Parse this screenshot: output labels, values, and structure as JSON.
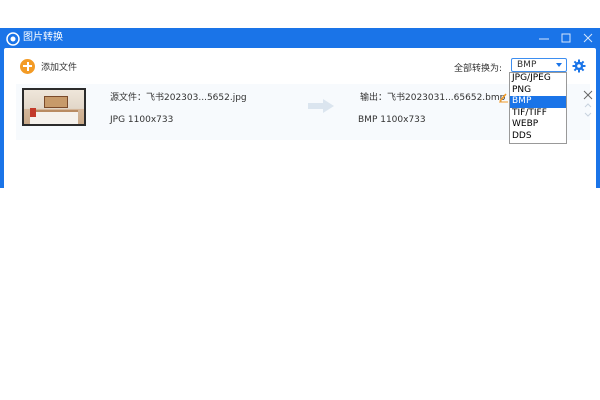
{
  "window": {
    "title": "图片转换",
    "app_icon": "eye-camera-icon",
    "controls": [
      "minimize-icon",
      "maximize-icon",
      "close-icon"
    ]
  },
  "toolbar": {
    "add_file_label": "添加文件",
    "convert_all_label": "全部转换为:",
    "format_selected": "BMP",
    "settings_icon": "gear-icon"
  },
  "file": {
    "source_name": "源文件：飞书202303...5652.jpg",
    "source_meta": "JPG  1100x733",
    "output_name": "输出：飞书2023031...65652.bmp",
    "output_meta": "BMP  1100x733"
  },
  "format_options": [
    "JPG/JPEG",
    "PNG",
    "BMP",
    "TIF/TIFF",
    "WEBP",
    "DDS"
  ],
  "colors": {
    "accent": "#1a74e8",
    "add_button": "#f39b25",
    "edit_icon": "#f39b25"
  }
}
